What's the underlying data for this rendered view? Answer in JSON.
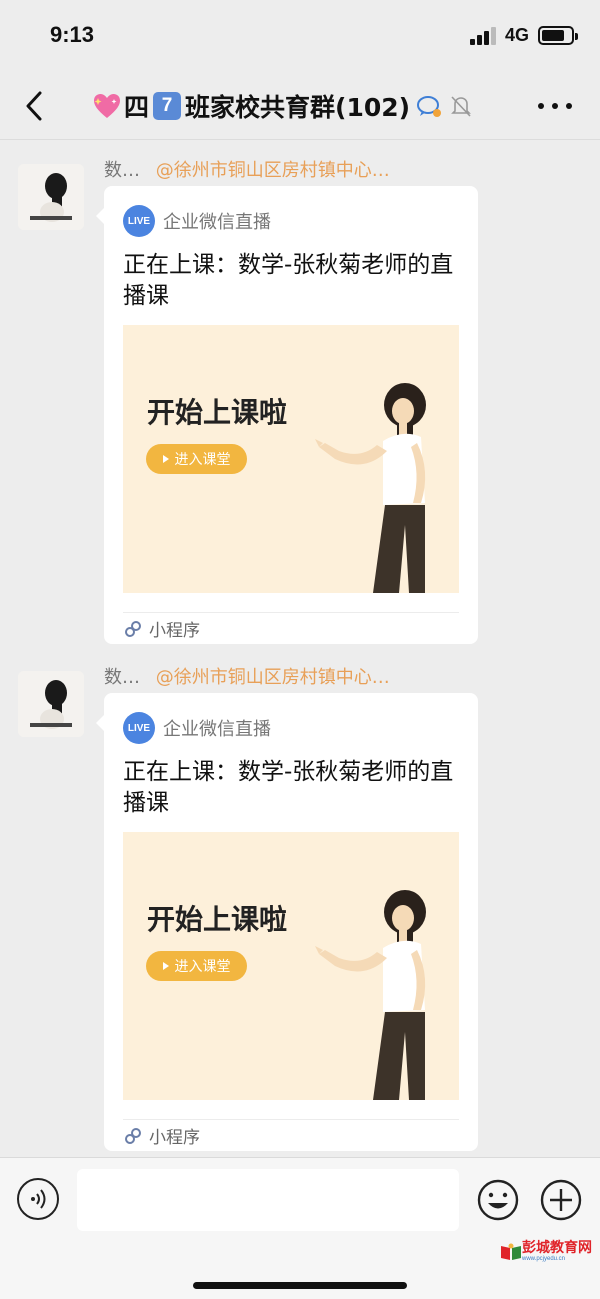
{
  "status_bar": {
    "time": "9:13",
    "network": "4G"
  },
  "nav": {
    "title_prefix": "四",
    "title_badge": "7",
    "title_suffix": "班家校共育群(102)",
    "icons": [
      "back-chevron-icon",
      "sparkling-heart-icon",
      "chat-bubble-icon",
      "mute-bell-icon",
      "more-dots-icon"
    ]
  },
  "messages": [
    {
      "sender_name": "数…",
      "mention": "@徐州市铜山区房村镇中心…",
      "card": {
        "source": "企业微信直播",
        "live_label": "LIVE",
        "title": "正在上课：数学-张秋菊老师的直播课",
        "banner_headline": "开始上课啦",
        "enter_button": "进入课堂",
        "footer_label": "小程序"
      }
    },
    {
      "sender_name": "数…",
      "mention": "@徐州市铜山区房村镇中心…",
      "card": {
        "source": "企业微信直播",
        "live_label": "LIVE",
        "title": "正在上课：数学-张秋菊老师的直播课",
        "banner_headline": "开始上课啦",
        "enter_button": "进入课堂",
        "footer_label": "小程序"
      }
    }
  ],
  "input_bar": {
    "placeholder": "",
    "value": ""
  },
  "watermark": {
    "main": "彭城教育网",
    "sub": "www.pcjyedu.cn"
  },
  "colors": {
    "background": "#ededed",
    "mention": "#e8a058",
    "live_badge": "#4b84e0",
    "banner_bg": "#fdf0da",
    "enter_button": "#f2b640",
    "title_badge": "#5a8ad6"
  }
}
